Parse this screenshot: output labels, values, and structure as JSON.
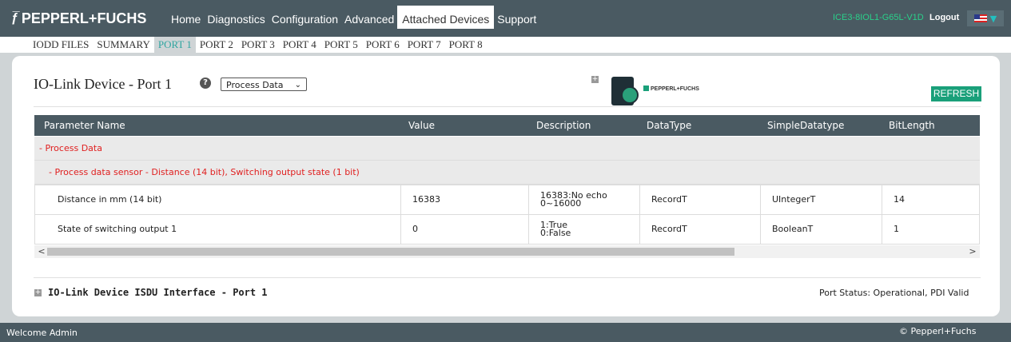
{
  "brand": {
    "mark": "ƒ̅",
    "name": "PEPPERL+FUCHS"
  },
  "nav": {
    "items": [
      "Home",
      "Diagnostics",
      "Configuration",
      "Advanced",
      "Attached Devices",
      "Support"
    ],
    "active": "Attached Devices",
    "device_id": "ICE3-8IOL1-G65L-V1D",
    "logout": "Logout"
  },
  "subnav": {
    "items": [
      "IODD FILES",
      "SUMMARY",
      "PORT 1",
      "PORT 2",
      "PORT 3",
      "PORT 4",
      "PORT 5",
      "PORT 6",
      "PORT 7",
      "PORT 8"
    ],
    "active": "PORT 1"
  },
  "card": {
    "title": "IO-Link Device - Port 1",
    "help": "?",
    "view_select": "Process Data",
    "refresh": "REFRESH",
    "device_brand": "PEPPERL+FUCHS"
  },
  "table": {
    "headers": [
      "Parameter Name",
      "Value",
      "Description",
      "DataType",
      "SimpleDatatype",
      "BitLength"
    ],
    "group1": "- Process Data",
    "group2": "- Process data sensor - Distance (14 bit), Switching output state (1 bit)",
    "rows": [
      {
        "name": "Distance in mm (14 bit)",
        "value": "16383",
        "desc1": "16383:No echo",
        "desc2": "0~16000",
        "datatype": "RecordT",
        "simple": "UIntegerT",
        "bits": "14"
      },
      {
        "name": "State of switching output 1",
        "value": "0",
        "desc1": "1:True",
        "desc2": "0:False",
        "datatype": "RecordT",
        "simple": "BooleanT",
        "bits": "1"
      }
    ]
  },
  "isdu": {
    "title": "IO-Link Device ISDU Interface - Port 1"
  },
  "port_status": "Port Status: Operational, PDI Valid",
  "footer": {
    "welcome": "Welcome Admin",
    "copyright": "© Pepperl+Fuchs"
  },
  "colors": {
    "header_bg": "#4a5a62",
    "accent": "#1aa07a",
    "active_port": "#2fa5a0",
    "group_text": "#e02020"
  }
}
